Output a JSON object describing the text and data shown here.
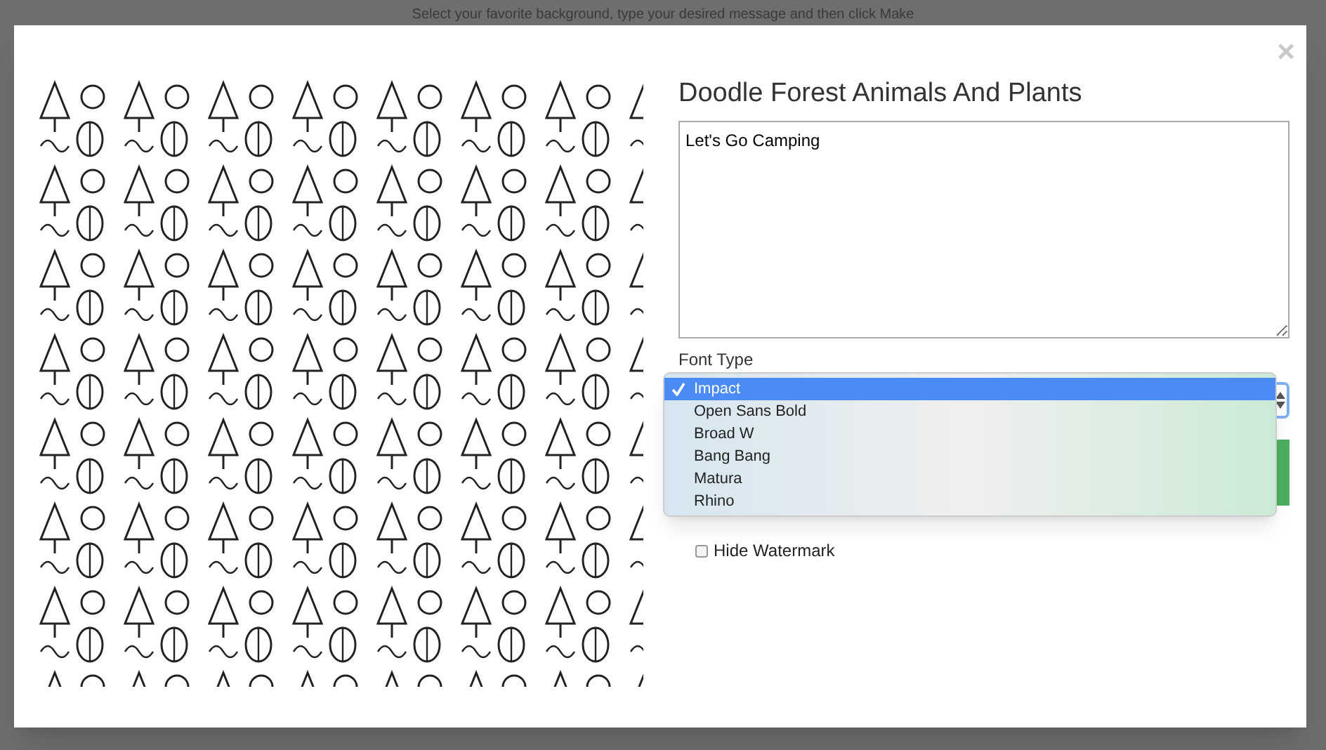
{
  "page_subtitle": "Select your favorite background, type your desired message and then click Make",
  "dialog": {
    "close": "×",
    "title": "Doodle Forest Animals And Plants",
    "message": "Let's Go Camping",
    "font_label": "Font Type",
    "font_options": [
      {
        "label": "Impact",
        "selected": true
      },
      {
        "label": "Open Sans Bold",
        "selected": false
      },
      {
        "label": "Broad W",
        "selected": false
      },
      {
        "label": "Bang Bang",
        "selected": false
      },
      {
        "label": "Matura",
        "selected": false
      },
      {
        "label": "Rhino",
        "selected": false
      }
    ],
    "hide_watermark": {
      "label": "Hide Watermark",
      "checked": false
    }
  }
}
